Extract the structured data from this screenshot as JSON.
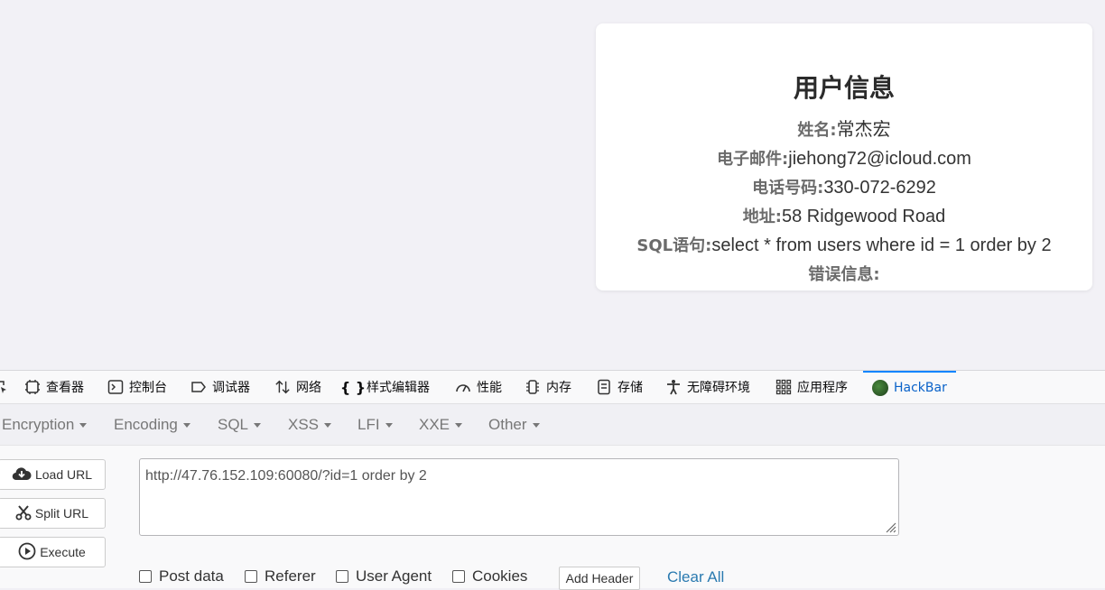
{
  "card": {
    "title": "用户信息",
    "rows": [
      {
        "label": "姓名:",
        "value": "常杰宏"
      },
      {
        "label": "电子邮件:",
        "value": "jiehong72@icloud.com"
      },
      {
        "label": "电话号码:",
        "value": "330-072-6292"
      },
      {
        "label": "地址:",
        "value": "58 Ridgewood Road"
      },
      {
        "label": "SQL语句:",
        "value": "select * from users where id = 1 order by 2"
      },
      {
        "label": "错误信息:",
        "value": ""
      }
    ]
  },
  "devtools": {
    "tabs": {
      "inspector": "查看器",
      "console": "控制台",
      "debugger": "调试器",
      "network": "网络",
      "style_editor": "样式编辑器",
      "performance": "性能",
      "memory": "内存",
      "storage": "存储",
      "accessibility": "无障碍环境",
      "application": "应用程序",
      "hackbar": "HackBar"
    },
    "active_tab": "HackBar"
  },
  "hackbar": {
    "menus": {
      "encryption": "Encryption",
      "encoding": "Encoding",
      "sql": "SQL",
      "xss": "XSS",
      "lfi": "LFI",
      "xxe": "XXE",
      "other": "Other"
    },
    "buttons": {
      "load_url": "Load URL",
      "split_url": "Split URL",
      "execute": "Execute"
    },
    "url": "http://47.76.152.109:60080/?id=1 order by 2",
    "options": {
      "post_data": "Post data",
      "referer": "Referer",
      "user_agent": "User Agent",
      "cookies": "Cookies"
    },
    "add_header": "Add Header",
    "clear_all": "Clear All"
  },
  "colors": {
    "page_bg": "#f2f1f6",
    "accent": "#0a84ff",
    "link": "#2a7ab0"
  }
}
